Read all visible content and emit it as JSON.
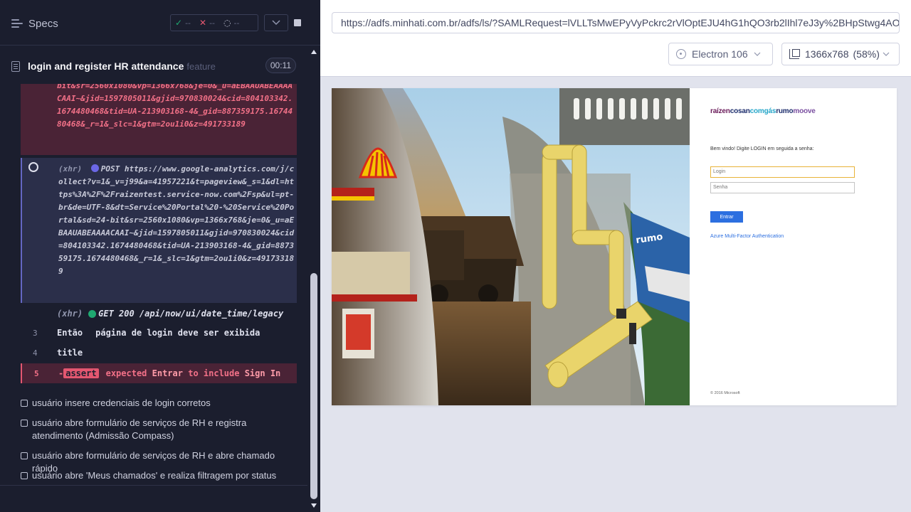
{
  "reporter": {
    "header": {
      "specs_label": "Specs",
      "stats": {
        "passed_symbol": "✓",
        "passed": "--",
        "failed_symbol": "✕",
        "failed": "--",
        "pending_symbol": "◌",
        "pending": "--"
      }
    },
    "runnable": {
      "title": "login and register HR attendance",
      "kind": "feature",
      "duration": "00:11"
    },
    "log": {
      "failed_text_tail": "bit&sr=2560x1080&vp=1366x768&je=0&_u=aEBAAUABEAAAACAAI~&jid=1597805011&gjid=970830024&cid=804103342.1674480468&tid=UA-213903168-4&_gid=887359175.1674480468&_r=1&_slc=1&gtm=2ou1i0&z=491733189",
      "xhr1": {
        "label": "(xhr)",
        "method_url": "POST https://www.google-analytics.com/j/collect?v=1&_v=j99&a=41957221&t=pageview&_s=1&dl=https%3A%2F%2Fraizentest.service-now.com%2Fsp&ul=pt-br&de=UTF-8&dt=Service%20Portal%20-%20Service%20Portal&sd=24-bit&sr=2560x1080&vp=1366x768&je=0&_u=aEBAAUABEAAAACAAI~&jid=1597805011&gjid=970830024&cid=804103342.1674480468&tid=UA-213903168-4&_gid=887359175.1674480468&_r=1&_slc=1&gtm=2ou1i0&z=491733189"
      },
      "xhr2": {
        "label": "(xhr)",
        "method_url": "GET 200 /api/now/ui/date_time/legacy"
      },
      "step3": {
        "num": "3",
        "keyword": "Então",
        "text": "página de login deve ser exibida"
      },
      "step4": {
        "num": "4",
        "text": "title"
      },
      "step5": {
        "num": "5",
        "prefix": "-",
        "badge": "assert",
        "expected": "expected",
        "value": "Entrar",
        "to_include": "to include",
        "target": "Sign In"
      }
    },
    "tests": [
      "usuário insere credenciais de login corretos",
      "usuário abre formulário de serviços de RH e registra atendimento (Admissão Compass)",
      "usuário abre formulário de serviços de RH e abre chamado rápido",
      "usuário abre 'Meus chamados' e realiza filtragem por status"
    ]
  },
  "aut": {
    "url": "https://adfs.minhati.com.br/adfs/ls/?SAMLRequest=lVLLTsMwEPyVyPckrc2rVlOptEJU4hG1hQO3rb2lIhl7eJ3y%2BHpStwg4AOKOSBm",
    "browser": "Electron 106",
    "viewport": "1366x768",
    "scale": "(58%)",
    "login_page": {
      "brand": {
        "p1": "raízen",
        "p2": "cosan",
        "p3": "comgás",
        "p4": "rumo",
        "p5": "moove"
      },
      "welcome": "Bem vindo! Digite LOGIN em seguida a senha:",
      "login_placeholder": "Login",
      "password_placeholder": "Senha",
      "submit": "Entrar",
      "mfa_link": "Azure Multi-Factor Authentication",
      "copyright": "© 2016 Microsoft"
    }
  },
  "colors": {
    "reporter_bg": "#1b1e2e",
    "fail_bg": "#4a2336",
    "fail_accent": "#e45770",
    "pass": "#1fa971",
    "submit": "#2c6fe0"
  }
}
